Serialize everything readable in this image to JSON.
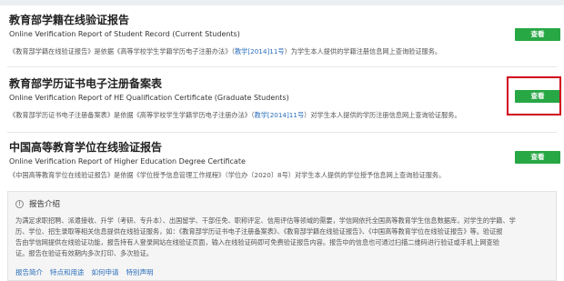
{
  "reports": [
    {
      "title": "教育部学籍在线验证报告",
      "subtitle": "Online Verification Report of Student Record (Current Students)",
      "desc_pre": "《教育部学籍在线验证报告》是依据《高等学校学生学籍学历电子注册办法》（",
      "desc_link": "教学[2014]11号",
      "desc_post": "）为学生本人提供的学籍注册信息网上查询验证服务。",
      "button_label": "查看"
    },
    {
      "title": "教育部学历证书电子注册备案表",
      "subtitle": "Online Verification Report of HE Qualification Certificate (Graduate Students)",
      "desc_pre": "《教育部学历证书电子注册备案表》是依据《高等学校学生学籍学历电子注册办法》（",
      "desc_link": "教学[2014]11号",
      "desc_post": "）对学生本人提供的学历注册信息网上查询验证服务。",
      "button_label": "查看"
    },
    {
      "title": "中国高等教育学位在线验证报告",
      "subtitle": "Online Verification Report of Higher Education Degree Certificate",
      "desc_pre": "《中国高等教育学位在线验证报告》是依据《学位授予信息管理工作规程》（学位办〔2020〕8号）对学生本人提供的学位授予信息网上查询验证服务。",
      "desc_link": "",
      "desc_post": "",
      "button_label": "查看"
    }
  ],
  "intro": {
    "title": "报告介绍",
    "lines": [
      "为满足求职招聘、派遣接收、升学（考研、专升本）、出国留学、干部任免、职称评定、信用评估等领域的需要，学信网依托全国高等教育学生信息数据库，对学生的学籍、学",
      "历、学位、招生录取等相关信息提供在线验证服务，如：《教育部学历证书电子注册备案表》、《教育部学籍在线验证报告》、《中国高等教育学位在线验证报告》等。验证报",
      "告由学信网提供在线验证功能，报告持有人登录网站在线验证页面，输入在线验证码即可免费验证报告内容。报告中的信息也可通过扫描二维码进行验证或手机上网查验",
      "证。报告在验证有效期内多次打印、多次验证。"
    ],
    "links": [
      "报告简介",
      "特点和用途",
      "如何申请",
      "特别声明"
    ]
  },
  "colors": {
    "accent_green": "#28a745",
    "link_blue": "#2a6ebb",
    "highlight_red": "#d0021b"
  },
  "icons": {
    "intro": "info-circle-icon"
  }
}
